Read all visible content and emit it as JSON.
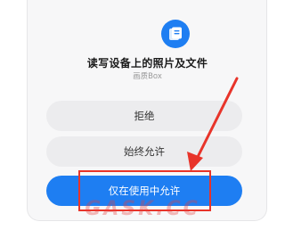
{
  "dialog": {
    "title": "读写设备上的照片及文件",
    "app_name": "画质Box",
    "icon": "file-folder-icon",
    "accent_color": "#1e7ef2"
  },
  "buttons": {
    "deny": "拒绝",
    "allow_always": "始终允许",
    "allow_while_using": "仅在使用中允许"
  },
  "annotation": {
    "highlight_color": "#e8342a",
    "watermark": "GASK.CC"
  }
}
